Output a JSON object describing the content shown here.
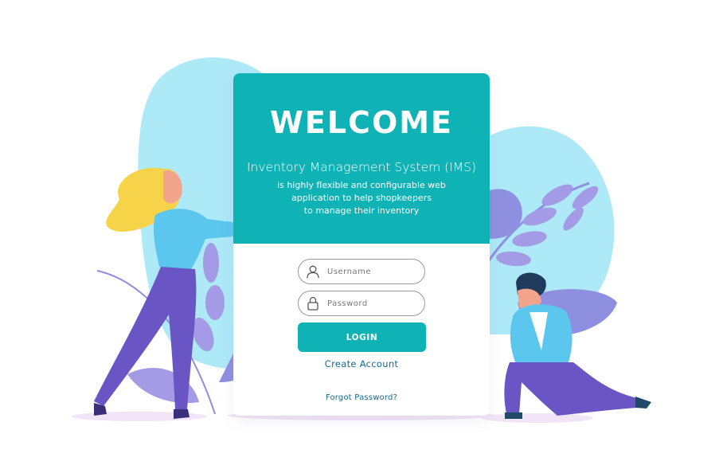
{
  "header": {
    "title": "WELCOME",
    "subtitle": "Inventory Management System (IMS)",
    "description_lines": [
      "is highly flexible and configurable web",
      "application to help shopkeepers",
      "to manage their inventory"
    ]
  },
  "form": {
    "username": {
      "placeholder": "Username",
      "value": "",
      "icon": "user-icon"
    },
    "password": {
      "placeholder": "Password",
      "value": "",
      "icon": "lock-icon"
    },
    "login_label": "LOGIN",
    "create_account_label": "Create Account",
    "forgot_password_label": "Forgot Password?"
  },
  "colors": {
    "accent": "#0fb2b5",
    "link": "#116b93",
    "blob": "#aee9f8",
    "leaf_purple": "#8f8fe0",
    "pants_purple": "#6a55c4",
    "shirt_blue": "#5bc7ee",
    "hair_yellow": "#f7d34a"
  }
}
